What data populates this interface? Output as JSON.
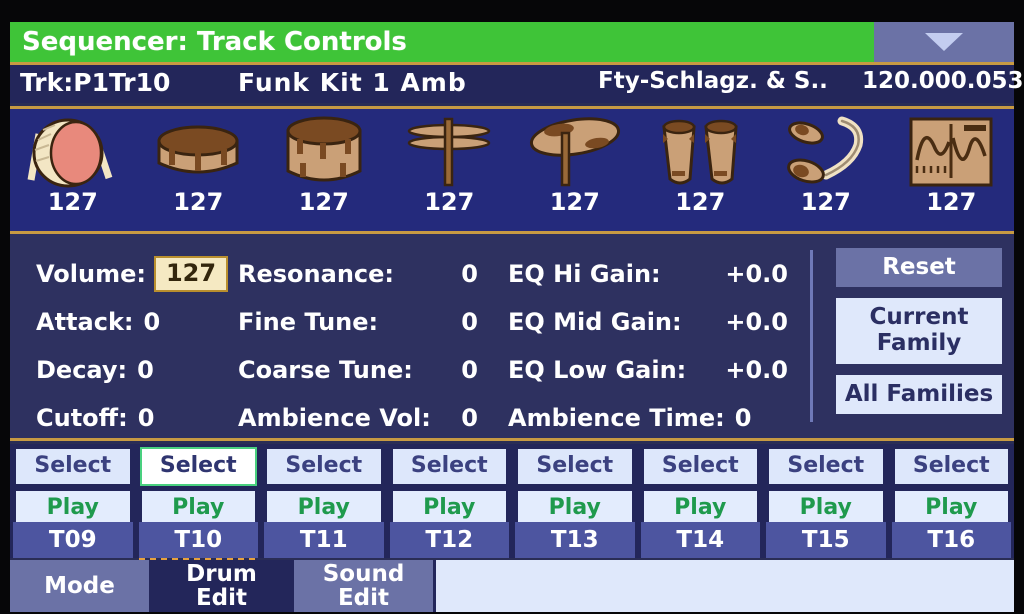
{
  "header": {
    "title": "Sequencer: Track Controls",
    "page_menu_icon": "chevron-down-icon"
  },
  "info_bar": {
    "track": "Trk:P1Tr10",
    "kit_name": "Funk Kit 1 Amb",
    "family": "Fty-Schlagz. & S..",
    "tempo": "120.000.053"
  },
  "drum_strip": [
    {
      "icon": "kick-drum-icon",
      "value": "127"
    },
    {
      "icon": "snare-drum-icon",
      "value": "127"
    },
    {
      "icon": "tom-drum-icon",
      "value": "127"
    },
    {
      "icon": "hihat-icon",
      "value": "127"
    },
    {
      "icon": "cymbal-icon",
      "value": "127"
    },
    {
      "icon": "conga-icon",
      "value": "127"
    },
    {
      "icon": "maracas-icon",
      "value": "127"
    },
    {
      "icon": "percussion-waveform-icon",
      "value": "127"
    }
  ],
  "parameters": {
    "column1": [
      {
        "label": "Volume:",
        "value": "127",
        "selected": true
      },
      {
        "label": "Attack:",
        "value": "0",
        "selected": false
      },
      {
        "label": "Decay:",
        "value": "0",
        "selected": false
      },
      {
        "label": "Cutoff:",
        "value": "0",
        "selected": false
      }
    ],
    "column2": [
      {
        "label": "Resonance:",
        "value": "0"
      },
      {
        "label": "Fine Tune:",
        "value": "0"
      },
      {
        "label": "Coarse Tune:",
        "value": "0"
      },
      {
        "label": "Ambience Vol:",
        "value": "0"
      }
    ],
    "column3": [
      {
        "label": "EQ Hi Gain:",
        "value": "+0.0"
      },
      {
        "label": "EQ Mid Gain:",
        "value": "+0.0"
      },
      {
        "label": "EQ Low Gain:",
        "value": "+0.0"
      },
      {
        "label": "Ambience Time:",
        "value": "0"
      }
    ]
  },
  "family_buttons": [
    {
      "label": "Reset",
      "style": "dark"
    },
    {
      "label": "Current\nFamily",
      "line1": "Current",
      "line2": "Family",
      "style": "light"
    },
    {
      "label": "All Families",
      "style": "light"
    }
  ],
  "pads": [
    {
      "select": "Select",
      "play": "Play",
      "selected": false
    },
    {
      "select": "Select",
      "play": "Play",
      "selected": true
    },
    {
      "select": "Select",
      "play": "Play",
      "selected": false
    },
    {
      "select": "Select",
      "play": "Play",
      "selected": false
    },
    {
      "select": "Select",
      "play": "Play",
      "selected": false
    },
    {
      "select": "Select",
      "play": "Play",
      "selected": false
    },
    {
      "select": "Select",
      "play": "Play",
      "selected": false
    },
    {
      "select": "Select",
      "play": "Play",
      "selected": false
    }
  ],
  "track_tabs": [
    {
      "label": "T09",
      "active": false
    },
    {
      "label": "T10",
      "active": true
    },
    {
      "label": "T11",
      "active": false
    },
    {
      "label": "T12",
      "active": false
    },
    {
      "label": "T13",
      "active": false
    },
    {
      "label": "T14",
      "active": false
    },
    {
      "label": "T15",
      "active": false
    },
    {
      "label": "T16",
      "active": false
    }
  ],
  "mode_tabs": [
    {
      "line1": "Mode",
      "line2": "",
      "active": false
    },
    {
      "line1": "Drum",
      "line2": "Edit",
      "active": true
    },
    {
      "line1": "Sound",
      "line2": "Edit",
      "active": false
    }
  ],
  "colors": {
    "title_bar": "#3fc438",
    "lcd_background": "#2a2d55",
    "drum_strip": "#242a7c",
    "gold_rule": "#c79a43",
    "selected_field": "#f5e9c2",
    "play_text": "#1f9a4d",
    "select_highlight": "#49d07f"
  }
}
